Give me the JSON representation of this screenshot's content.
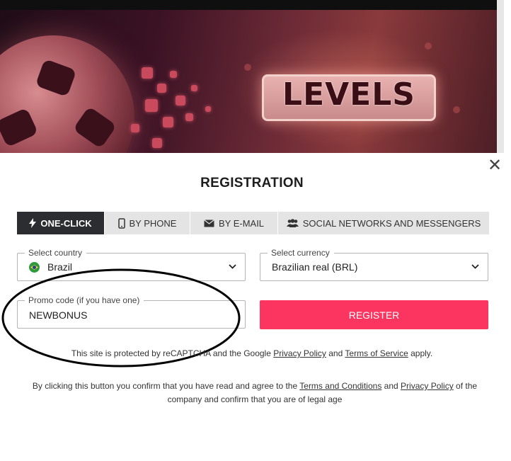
{
  "banner": {
    "text": "LEVELS"
  },
  "modal": {
    "close_label": "✕",
    "title": "REGISTRATION",
    "tabs": [
      {
        "label": "ONE-CLICK",
        "icon": "lightning-icon"
      },
      {
        "label": "BY PHONE",
        "icon": "phone-icon"
      },
      {
        "label": "BY E-MAIL",
        "icon": "envelope-icon"
      },
      {
        "label": "SOCIAL NETWORKS AND MESSENGERS",
        "icon": "users-icon"
      }
    ],
    "country": {
      "legend": "Select country",
      "value": "Brazil",
      "icon": "brazil-flag-icon"
    },
    "currency": {
      "legend": "Select currency",
      "value": "Brazilian real (BRL)"
    },
    "promo": {
      "legend": "Promo code (if you have one)",
      "value": "NEWBONUS"
    },
    "register_label": "REGISTER",
    "captcha": {
      "prefix": "This site is protected by reCAPTCHA and the Google ",
      "privacy": "Privacy Policy",
      "and": " and ",
      "terms": "Terms of Service",
      "suffix": " apply."
    },
    "terms": {
      "prefix": "By clicking this button you confirm that you have read and agree to the ",
      "terms_link": "Terms and Conditions",
      "and": " and ",
      "privacy_link": "Privacy Policy",
      "suffix": " of the company and confirm that you are of legal age"
    }
  },
  "colors": {
    "accent": "#fb3560",
    "active_tab": "#2c2d30",
    "tab_bg": "#e4e4e4"
  }
}
